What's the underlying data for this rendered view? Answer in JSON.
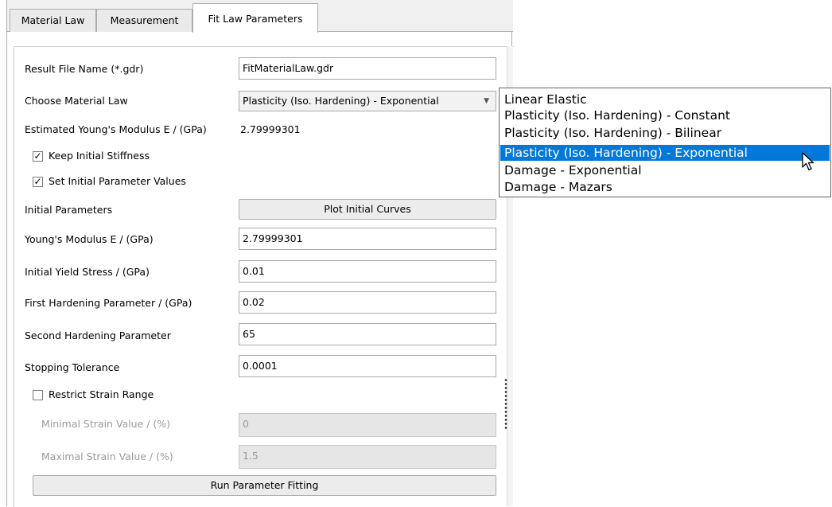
{
  "tabs": [
    {
      "label": "Material Law"
    },
    {
      "label": "Measurement"
    },
    {
      "label": "Fit Law Parameters"
    }
  ],
  "form": {
    "result_file_label": "Result File Name (*.gdr)",
    "result_file_value": "FitMaterialLaw.gdr",
    "material_law_label": "Choose Material Law",
    "material_law_selected": "Plasticity (Iso. Hardening) - Exponential",
    "estimated_modulus_label": "Estimated Young's Modulus E / (GPa)",
    "estimated_modulus_value": "2.79999301",
    "keep_stiffness_label": "Keep Initial Stiffness",
    "keep_stiffness_checked": "✓",
    "set_initial_label": "Set Initial Parameter Values",
    "set_initial_checked": "✓",
    "initial_params_label": "Initial Parameters",
    "plot_button": "Plot Initial Curves",
    "youngs_label": "Young's Modulus E / (GPa)",
    "youngs_value": "2.79999301",
    "yield_label": "Initial Yield Stress / (GPa)",
    "yield_value": "0.01",
    "first_hard_label": "First Hardening Parameter / (GPa)",
    "first_hard_value": "0.02",
    "second_hard_label": "Second Hardening Parameter",
    "second_hard_value": "65",
    "tolerance_label": "Stopping Tolerance",
    "tolerance_value": "0.0001",
    "restrict_label": "Restrict Strain Range",
    "min_strain_label": "Minimal Strain Value / (%)",
    "min_strain_value": "0",
    "max_strain_label": "Maximal Strain Value / (%)",
    "max_strain_value": "1.5",
    "run_button": "Run Parameter Fitting"
  },
  "dropdown": {
    "options": [
      "Linear Elastic",
      "Plasticity (Iso. Hardening) - Constant",
      "Plasticity (Iso. Hardening) - Bilinear",
      "Plasticity (Iso. Hardening) - Exponential",
      "Damage - Exponential",
      "Damage - Mazars"
    ],
    "highlight_color": "#0078d7"
  },
  "icons": {
    "combo_arrow": "chevron-down-icon",
    "cursor": "mouse-pointer-icon"
  }
}
